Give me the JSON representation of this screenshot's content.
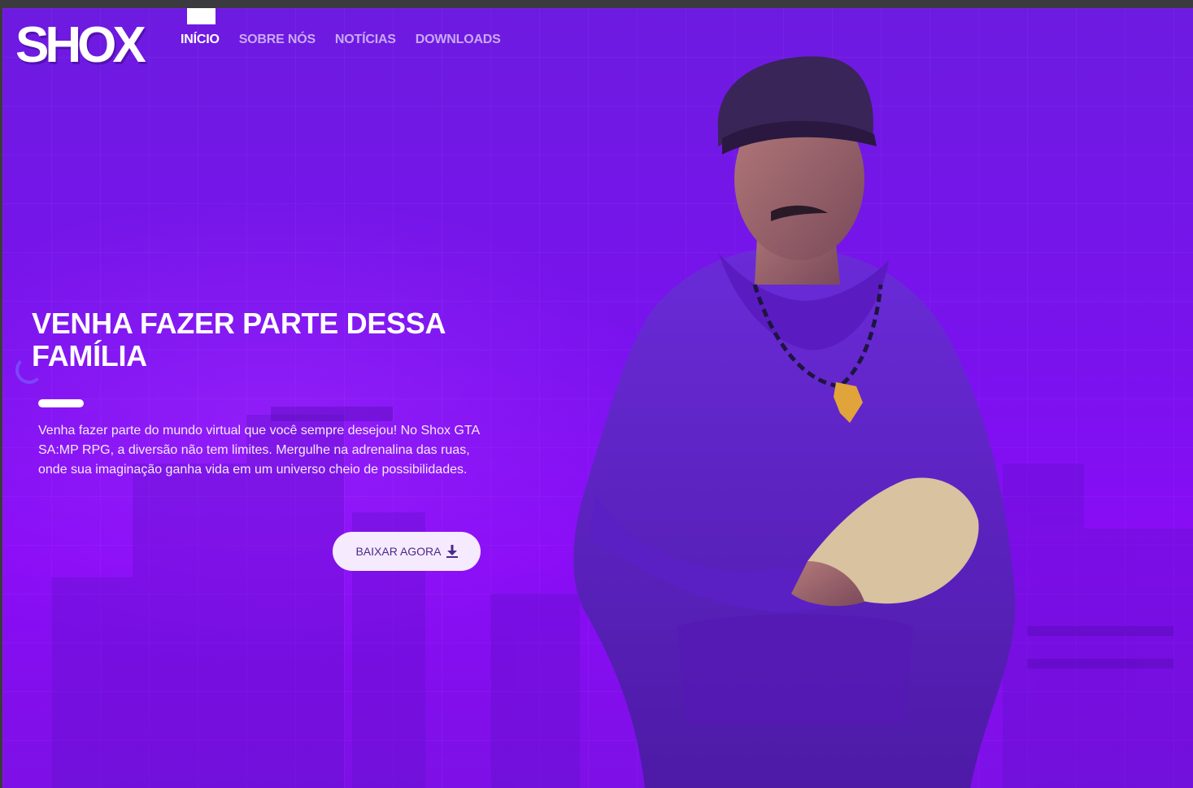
{
  "brand": {
    "logo_text": "SHOX"
  },
  "nav": {
    "items": [
      {
        "label": "INÍCIO",
        "active": true
      },
      {
        "label": "SOBRE NÓS",
        "active": false
      },
      {
        "label": "NOTÍCIAS",
        "active": false
      },
      {
        "label": "DOWNLOADS",
        "active": false
      }
    ]
  },
  "hero": {
    "headline": "VENHA FAZER PARTE DESSA FAMÍLIA",
    "description": "Venha fazer parte do mundo virtual que você sempre desejou! No Shox GTA SA:MP RPG, a diversão não tem limites. Mergulhe na adrenalina das ruas, onde sua imaginação ganha vida em um universo cheio de possibilidades.",
    "cta_label": "BAIXAR AGORA",
    "cta_icon": "download-icon"
  },
  "colors": {
    "background": "#7a12ee",
    "nav_active": "#ffffff",
    "nav_inactive": "#c9a9f5",
    "cta_background": "#f6eaff",
    "cta_text": "#4a2a88"
  }
}
